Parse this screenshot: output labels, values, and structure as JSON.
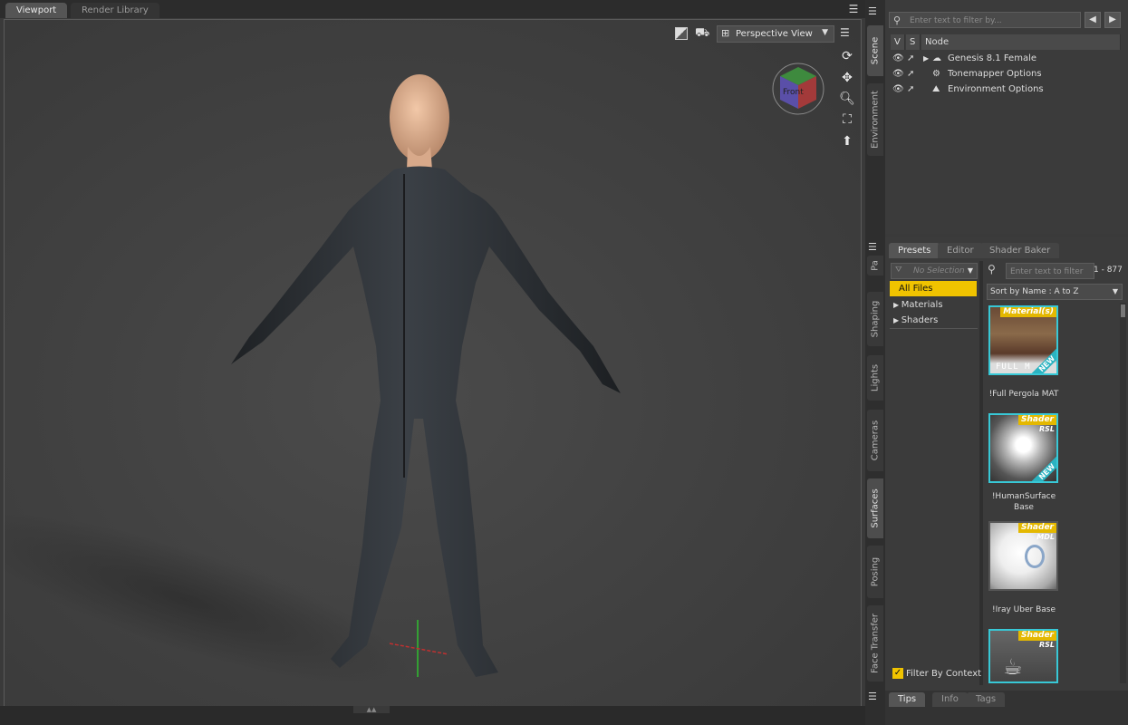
{
  "tabs": {
    "viewport": "Viewport",
    "render_library": "Render Library"
  },
  "viewport": {
    "view_mode": "Perspective View",
    "nav_cube_label": "Front"
  },
  "side_tabs": {
    "scene": "Scene",
    "environment": "Environment",
    "parameters": "Pa",
    "shaping": "Shaping",
    "lights": "Lights",
    "cameras": "Cameras",
    "surfaces": "Surfaces",
    "posing": "Posing",
    "face_transfer": "Face Transfer"
  },
  "scene": {
    "filter_placeholder": "Enter text to filter by...",
    "columns": {
      "v": "V",
      "s": "S",
      "node": "Node"
    },
    "nodes": [
      {
        "label": "Genesis 8.1 Female"
      },
      {
        "label": "Tonemapper Options"
      },
      {
        "label": "Environment Options"
      }
    ]
  },
  "presets": {
    "tabs": [
      "Presets",
      "Editor",
      "Shader Baker"
    ],
    "selection": "No Selection",
    "filter_placeholder": "Enter text to filter by...",
    "count_range": "1 - 877",
    "sort": "Sort by Name : A to Z",
    "categories": [
      "All Files",
      "Materials",
      "Shaders"
    ],
    "filter_by_context": "Filter By Context",
    "items": [
      {
        "label": "!Full Pergola MAT",
        "badge": "Material(s)",
        "sub": "",
        "thumb_text": "FULL M",
        "new": "NEW"
      },
      {
        "label": "!HumanSurface Base",
        "badge": "Shader",
        "sub": "RSL",
        "thumb_text": "",
        "new": "NEW"
      },
      {
        "label": "!Iray Uber Base",
        "badge": "Shader",
        "sub": "MDL",
        "thumb_text": "",
        "new": ""
      },
      {
        "label": "",
        "badge": "Shader",
        "sub": "RSL",
        "thumb_text": "",
        "new": ""
      }
    ]
  },
  "bottom_tabs": [
    "Tips",
    "Info",
    "Tags"
  ],
  "colors": {
    "accent_yellow": "#e4b800",
    "thumb_border": "#38c8d6",
    "selected_row": "#f0c300"
  }
}
